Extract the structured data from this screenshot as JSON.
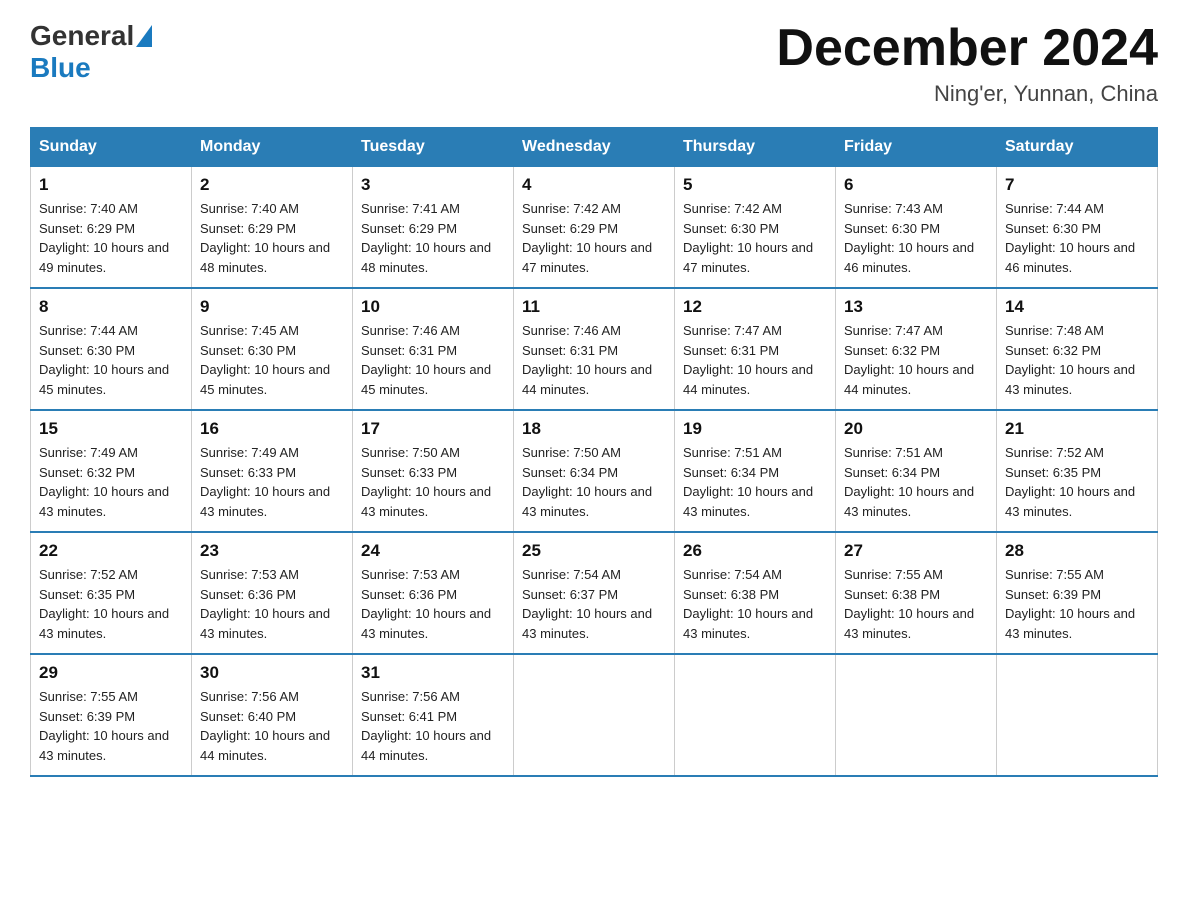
{
  "header": {
    "logo_general": "General",
    "logo_blue": "Blue",
    "month_title": "December 2024",
    "location": "Ning'er, Yunnan, China"
  },
  "days_of_week": [
    "Sunday",
    "Monday",
    "Tuesday",
    "Wednesday",
    "Thursday",
    "Friday",
    "Saturday"
  ],
  "weeks": [
    [
      {
        "day": "1",
        "sunrise": "7:40 AM",
        "sunset": "6:29 PM",
        "daylight": "10 hours and 49 minutes."
      },
      {
        "day": "2",
        "sunrise": "7:40 AM",
        "sunset": "6:29 PM",
        "daylight": "10 hours and 48 minutes."
      },
      {
        "day": "3",
        "sunrise": "7:41 AM",
        "sunset": "6:29 PM",
        "daylight": "10 hours and 48 minutes."
      },
      {
        "day": "4",
        "sunrise": "7:42 AM",
        "sunset": "6:29 PM",
        "daylight": "10 hours and 47 minutes."
      },
      {
        "day": "5",
        "sunrise": "7:42 AM",
        "sunset": "6:30 PM",
        "daylight": "10 hours and 47 minutes."
      },
      {
        "day": "6",
        "sunrise": "7:43 AM",
        "sunset": "6:30 PM",
        "daylight": "10 hours and 46 minutes."
      },
      {
        "day": "7",
        "sunrise": "7:44 AM",
        "sunset": "6:30 PM",
        "daylight": "10 hours and 46 minutes."
      }
    ],
    [
      {
        "day": "8",
        "sunrise": "7:44 AM",
        "sunset": "6:30 PM",
        "daylight": "10 hours and 45 minutes."
      },
      {
        "day": "9",
        "sunrise": "7:45 AM",
        "sunset": "6:30 PM",
        "daylight": "10 hours and 45 minutes."
      },
      {
        "day": "10",
        "sunrise": "7:46 AM",
        "sunset": "6:31 PM",
        "daylight": "10 hours and 45 minutes."
      },
      {
        "day": "11",
        "sunrise": "7:46 AM",
        "sunset": "6:31 PM",
        "daylight": "10 hours and 44 minutes."
      },
      {
        "day": "12",
        "sunrise": "7:47 AM",
        "sunset": "6:31 PM",
        "daylight": "10 hours and 44 minutes."
      },
      {
        "day": "13",
        "sunrise": "7:47 AM",
        "sunset": "6:32 PM",
        "daylight": "10 hours and 44 minutes."
      },
      {
        "day": "14",
        "sunrise": "7:48 AM",
        "sunset": "6:32 PM",
        "daylight": "10 hours and 43 minutes."
      }
    ],
    [
      {
        "day": "15",
        "sunrise": "7:49 AM",
        "sunset": "6:32 PM",
        "daylight": "10 hours and 43 minutes."
      },
      {
        "day": "16",
        "sunrise": "7:49 AM",
        "sunset": "6:33 PM",
        "daylight": "10 hours and 43 minutes."
      },
      {
        "day": "17",
        "sunrise": "7:50 AM",
        "sunset": "6:33 PM",
        "daylight": "10 hours and 43 minutes."
      },
      {
        "day": "18",
        "sunrise": "7:50 AM",
        "sunset": "6:34 PM",
        "daylight": "10 hours and 43 minutes."
      },
      {
        "day": "19",
        "sunrise": "7:51 AM",
        "sunset": "6:34 PM",
        "daylight": "10 hours and 43 minutes."
      },
      {
        "day": "20",
        "sunrise": "7:51 AM",
        "sunset": "6:34 PM",
        "daylight": "10 hours and 43 minutes."
      },
      {
        "day": "21",
        "sunrise": "7:52 AM",
        "sunset": "6:35 PM",
        "daylight": "10 hours and 43 minutes."
      }
    ],
    [
      {
        "day": "22",
        "sunrise": "7:52 AM",
        "sunset": "6:35 PM",
        "daylight": "10 hours and 43 minutes."
      },
      {
        "day": "23",
        "sunrise": "7:53 AM",
        "sunset": "6:36 PM",
        "daylight": "10 hours and 43 minutes."
      },
      {
        "day": "24",
        "sunrise": "7:53 AM",
        "sunset": "6:36 PM",
        "daylight": "10 hours and 43 minutes."
      },
      {
        "day": "25",
        "sunrise": "7:54 AM",
        "sunset": "6:37 PM",
        "daylight": "10 hours and 43 minutes."
      },
      {
        "day": "26",
        "sunrise": "7:54 AM",
        "sunset": "6:38 PM",
        "daylight": "10 hours and 43 minutes."
      },
      {
        "day": "27",
        "sunrise": "7:55 AM",
        "sunset": "6:38 PM",
        "daylight": "10 hours and 43 minutes."
      },
      {
        "day": "28",
        "sunrise": "7:55 AM",
        "sunset": "6:39 PM",
        "daylight": "10 hours and 43 minutes."
      }
    ],
    [
      {
        "day": "29",
        "sunrise": "7:55 AM",
        "sunset": "6:39 PM",
        "daylight": "10 hours and 43 minutes."
      },
      {
        "day": "30",
        "sunrise": "7:56 AM",
        "sunset": "6:40 PM",
        "daylight": "10 hours and 44 minutes."
      },
      {
        "day": "31",
        "sunrise": "7:56 AM",
        "sunset": "6:41 PM",
        "daylight": "10 hours and 44 minutes."
      },
      null,
      null,
      null,
      null
    ]
  ]
}
